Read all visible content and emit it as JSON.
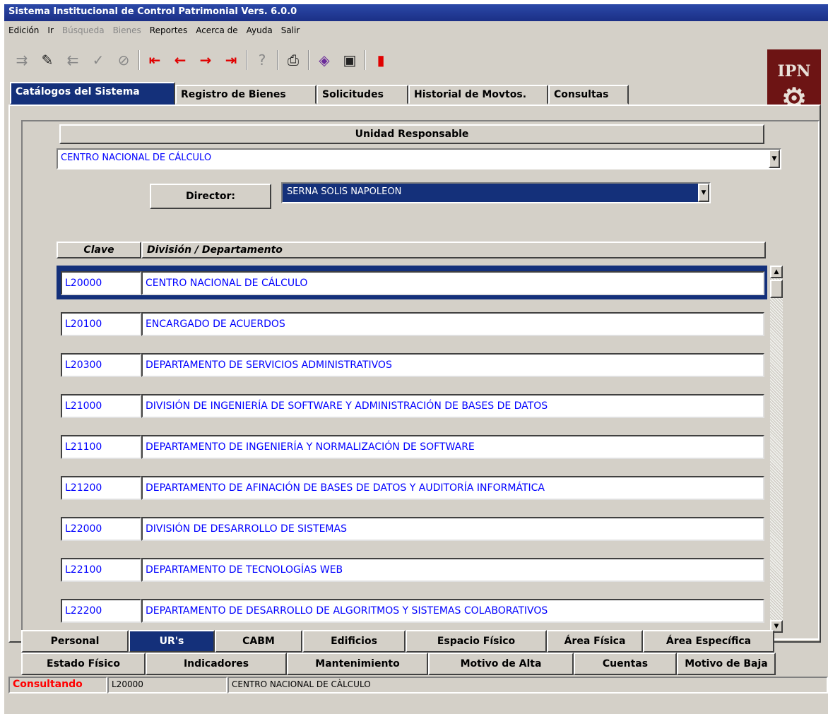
{
  "title": "Sistema Institucional de Control Patrimonial Vers. 6.0.0",
  "menu": [
    {
      "label": "Edición",
      "enabled": true
    },
    {
      "label": "Ir",
      "enabled": true
    },
    {
      "label": "Búsqueda",
      "enabled": false
    },
    {
      "label": "Bienes",
      "enabled": false
    },
    {
      "label": "Reportes",
      "enabled": true
    },
    {
      "label": "Acerca de",
      "enabled": true
    },
    {
      "label": "Ayuda",
      "enabled": true
    },
    {
      "label": "Salir",
      "enabled": true
    }
  ],
  "toolbar": {
    "icons": [
      "insert-icon",
      "edit-icon",
      "delete-icon",
      "accept-icon",
      "cancel-icon",
      "first-icon",
      "prev-icon",
      "next-icon",
      "last-icon",
      "query-icon",
      "print-icon",
      "book-icon",
      "save-icon",
      "exit-icon"
    ]
  },
  "logo_text": "IPN",
  "main_tabs": [
    "Catálogos del Sistema",
    "Registro de Bienes",
    "Solicitudes",
    "Historial de Movtos.",
    "Consultas"
  ],
  "main_tab_active": 0,
  "unidad": {
    "header": "Unidad Responsable",
    "value": "CENTRO NACIONAL DE CÁLCULO"
  },
  "director": {
    "label": "Director:",
    "value": "SERNA SOLIS NAPOLEON"
  },
  "grid": {
    "col_key": "Clave",
    "col_desc": "División / Departamento",
    "rows": [
      {
        "clave": "L20000",
        "desc": "CENTRO NACIONAL DE CÁLCULO"
      },
      {
        "clave": "L20100",
        "desc": "ENCARGADO DE ACUERDOS"
      },
      {
        "clave": "L20300",
        "desc": "DEPARTAMENTO DE SERVICIOS ADMINISTRATIVOS"
      },
      {
        "clave": "L21000",
        "desc": "DIVISIÓN DE INGENIERÍA DE SOFTWARE Y ADMINISTRACIÓN DE BASES DE DATOS"
      },
      {
        "clave": "L21100",
        "desc": "DEPARTAMENTO DE INGENIERÍA Y NORMALIZACIÓN DE SOFTWARE"
      },
      {
        "clave": "L21200",
        "desc": "DEPARTAMENTO DE AFINACIÓN DE BASES DE DATOS Y AUDITORÍA INFORMÁTICA"
      },
      {
        "clave": "L22000",
        "desc": "DIVISIÓN DE DESARROLLO DE SISTEMAS"
      },
      {
        "clave": "L22100",
        "desc": "DEPARTAMENTO DE TECNOLOGÍAS WEB"
      },
      {
        "clave": "L22200",
        "desc": "DEPARTAMENTO DE DESARROLLO DE ALGORITMOS Y SISTEMAS COLABORATIVOS"
      }
    ]
  },
  "bottom_tabs_row1": [
    "Personal",
    "UR's",
    "CABM",
    "Edificios",
    "Espacio Físico",
    "Área Física",
    "Área Específica"
  ],
  "bottom_tabs_row1_active": 1,
  "bottom_tabs_row2": [
    "Estado Físico",
    "Indicadores",
    "Mantenimiento",
    "Motivo de Alta",
    "Cuentas",
    "Motivo de Baja"
  ],
  "status": {
    "mode": "Consultando",
    "clave": "L20000",
    "desc": "CENTRO NACIONAL DE CÀLCULO"
  }
}
